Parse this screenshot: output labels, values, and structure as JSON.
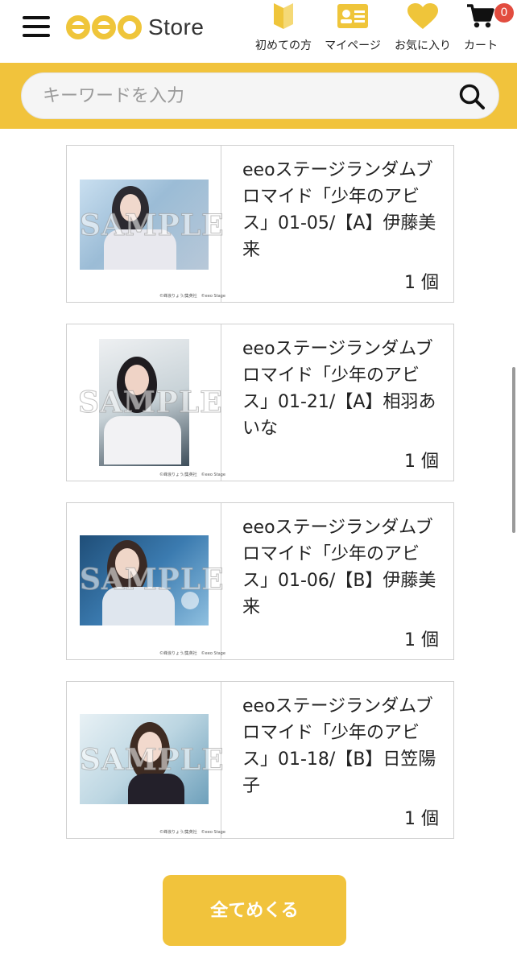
{
  "header": {
    "logo_text": "Store",
    "nav": [
      {
        "label": "初めての方",
        "icon": "beginner-mark-icon"
      },
      {
        "label": "マイページ",
        "icon": "id-card-icon"
      },
      {
        "label": "お気に入り",
        "icon": "heart-icon"
      },
      {
        "label": "カート",
        "icon": "cart-icon",
        "badge": "0"
      }
    ]
  },
  "search": {
    "placeholder": "キーワードを入力"
  },
  "products": [
    {
      "title": "eeoステージランダムブロマイド「少年のアビス」01-05/【A】伊藤美来",
      "quantity": "1 個",
      "watermark": "SAMPLE",
      "credit": "©峰浪りょう/集英社　©eeo Stage"
    },
    {
      "title": "eeoステージランダムブロマイド「少年のアビス」01-21/【A】相羽あいな",
      "quantity": "1 個",
      "watermark": "SAMPLE",
      "credit": "©峰浪りょう/集英社　©eeo Stage"
    },
    {
      "title": "eeoステージランダムブロマイド「少年のアビス」01-06/【B】伊藤美来",
      "quantity": "1 個",
      "watermark": "SAMPLE",
      "credit": "©峰浪りょう/集英社　©eeo Stage"
    },
    {
      "title": "eeoステージランダムブロマイド「少年のアビス」01-18/【B】日笠陽子",
      "quantity": "1 個",
      "watermark": "SAMPLE",
      "credit": "©峰浪りょう/集英社　©eeo Stage"
    }
  ],
  "actions": {
    "view_all": "全てめくる"
  },
  "colors": {
    "accent": "#f1c33c",
    "badge": "#e24c3f"
  }
}
